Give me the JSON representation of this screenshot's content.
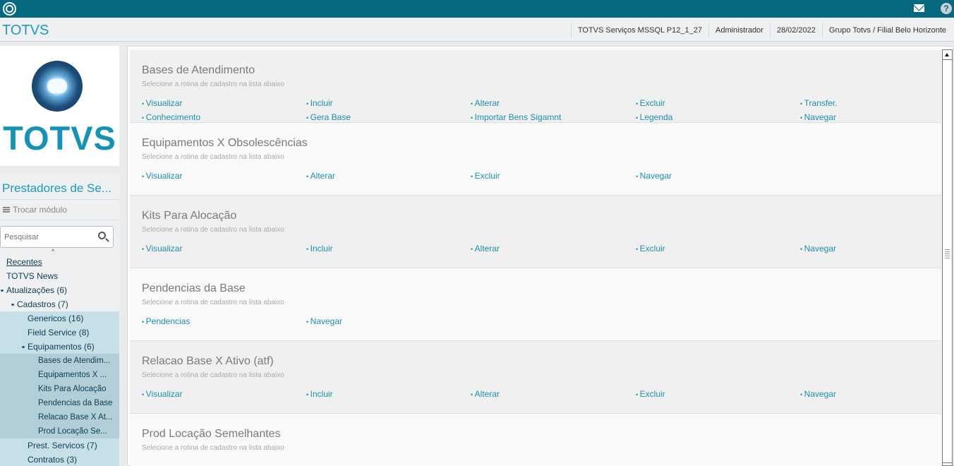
{
  "header": {
    "app_title": "TOTVS",
    "info": [
      "TOTVS Serviços MSSQL P12_1_27",
      "Administrador",
      "28/02/2022",
      "Grupo Totvs / Filial Belo Horizonte"
    ]
  },
  "topbar": {
    "help_label": "?"
  },
  "sidebar": {
    "logo_text": "TOTVS",
    "module_name": "Prestadores de Se...",
    "switch_module": "Trocar módulo",
    "search_placeholder": "Pesquisar",
    "collapse": "^",
    "tree": [
      {
        "label": "Recentes",
        "level": 0,
        "underline": true
      },
      {
        "label": "TOTVS News",
        "level": 0
      },
      {
        "label": "Atualizações (6)",
        "level": 0,
        "expanded": true
      },
      {
        "label": "Cadastros (7)",
        "level": 1,
        "expanded": true
      },
      {
        "label": "Genericos (16)",
        "level": 2
      },
      {
        "label": "Field Service (8)",
        "level": 2
      },
      {
        "label": "Equipamentos (6)",
        "level": 2,
        "expanded": true
      },
      {
        "label": "Bases de Atendim...",
        "level": 3
      },
      {
        "label": "Equipamentos X ...",
        "level": 3
      },
      {
        "label": "Kits Para Alocação",
        "level": 3
      },
      {
        "label": "Pendencias da Base",
        "level": 3
      },
      {
        "label": "Relacao Base X At...",
        "level": 3
      },
      {
        "label": "Prod Locação Se...",
        "level": 3
      },
      {
        "label": "Prest. Servicos (7)",
        "level": 2
      },
      {
        "label": "Contratos (3)",
        "level": 2
      }
    ]
  },
  "main": {
    "subtitle": "Selecione a rotina de cadastro na lista abaixo",
    "sections": [
      {
        "title": "Bases de Atendimento",
        "rows": [
          [
            "Visualizar",
            "Incluir",
            "Alterar",
            "Excluir",
            "Transfer."
          ],
          [
            "Conhecimento",
            "Gera Base",
            "Importar Bens Sigamnt",
            "Legenda",
            "Navegar"
          ]
        ]
      },
      {
        "title": "Equipamentos X Obsolescências",
        "rows": [
          [
            "Visualizar",
            "Alterar",
            "Excluir",
            "Navegar"
          ]
        ]
      },
      {
        "title": "Kits Para Alocação",
        "rows": [
          [
            "Visualizar",
            "Incluir",
            "Alterar",
            "Excluir",
            "Navegar"
          ]
        ]
      },
      {
        "title": "Pendencias da Base",
        "rows": [
          [
            "Pendencias",
            "Navegar"
          ]
        ]
      },
      {
        "title": "Relacao Base X Ativo (atf)",
        "rows": [
          [
            "Visualizar",
            "Incluir",
            "Alterar",
            "Excluir",
            "Navegar"
          ]
        ]
      },
      {
        "title": "Prod Locação Semelhantes",
        "rows": []
      }
    ]
  }
}
